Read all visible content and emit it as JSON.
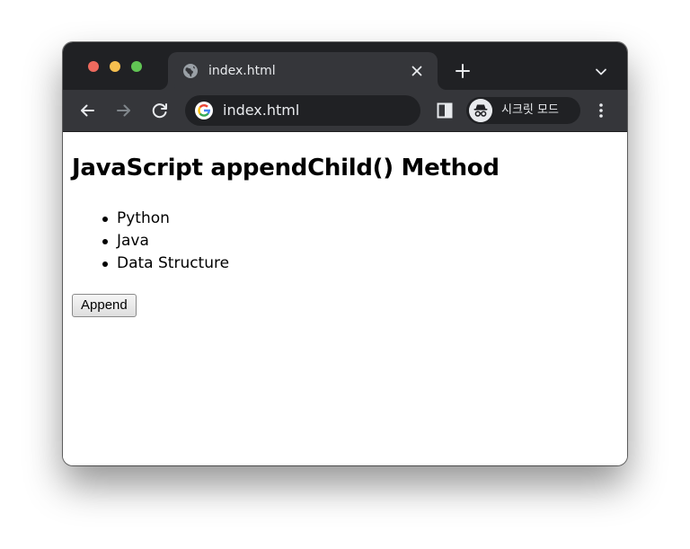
{
  "browser": {
    "tab": {
      "title": "index.html",
      "favicon": "globe-icon"
    },
    "omnibox": {
      "url": "index.html",
      "site_icon": "google-g-icon"
    },
    "incognito_label": "시크릿 모드",
    "theme": {
      "tabstrip_bg": "#202124",
      "toolbar_bg": "#35363a",
      "text": "#e8eaed"
    }
  },
  "page": {
    "heading": "JavaScript appendChild() Method",
    "list_items": [
      "Python",
      "Java",
      "Data Structure"
    ],
    "button_label": "Append"
  }
}
